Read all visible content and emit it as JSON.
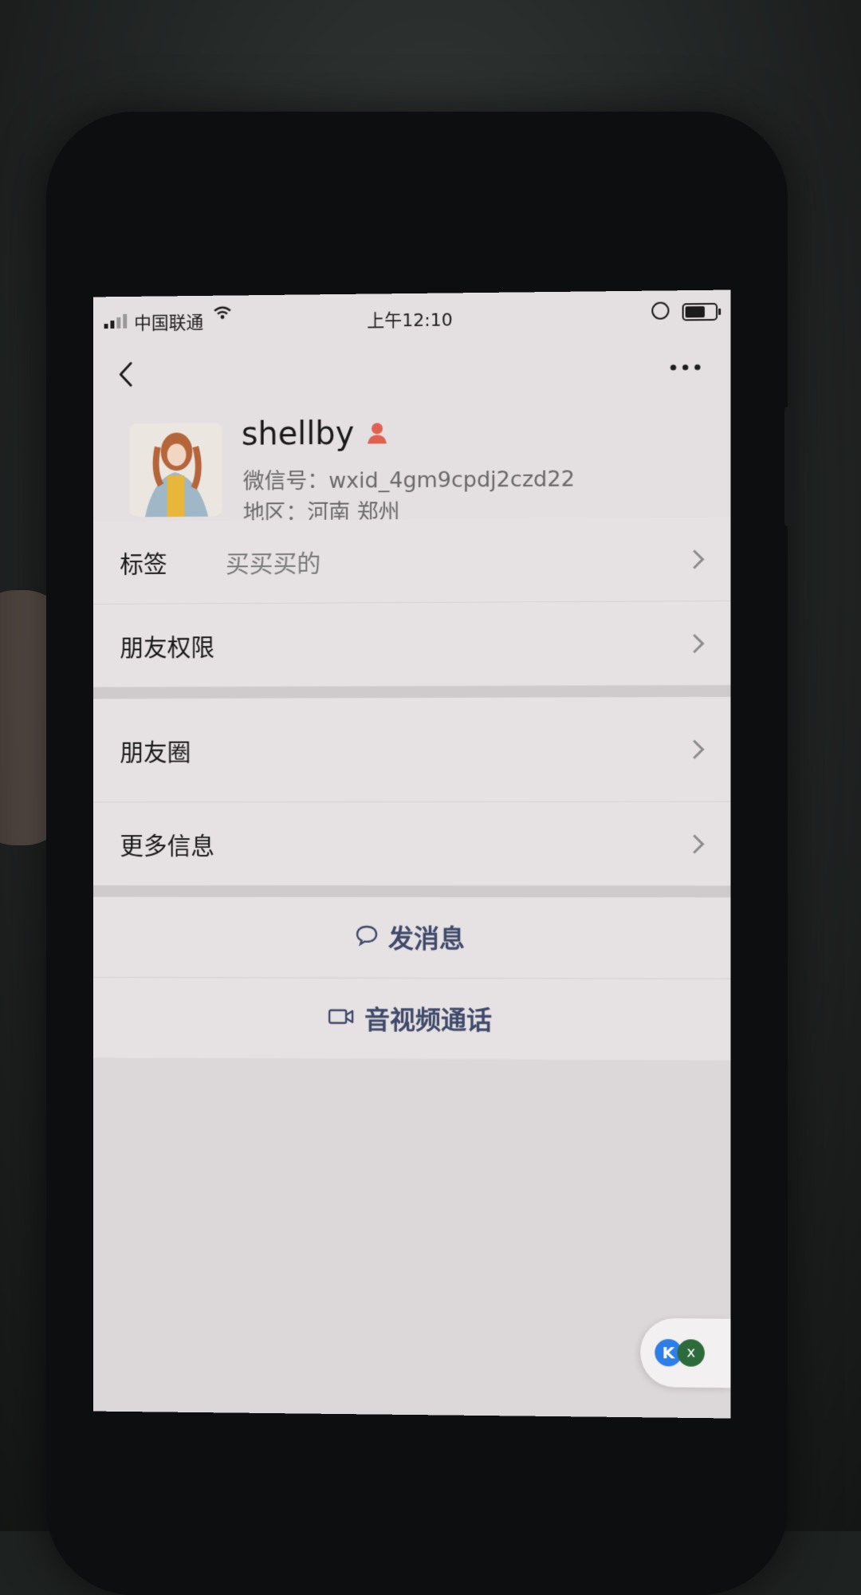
{
  "status_bar": {
    "carrier": "中国联通",
    "time": "上午12:10",
    "battery_level": 0.6
  },
  "nav": {
    "back_icon": "chevron-left-icon",
    "more_icon": "ellipsis-icon"
  },
  "profile": {
    "name": "shellby",
    "gender_icon": "female-icon",
    "gender_color": "#e0614f",
    "wechat_id": "微信号：wxid_4gm9cpdj2czd22",
    "region": "地区：河南 郑州"
  },
  "rows": {
    "tags": {
      "label": "标签",
      "value": "买买买的"
    },
    "permissions": {
      "label": "朋友权限"
    },
    "moments": {
      "label": "朋友圈"
    },
    "more_info": {
      "label": "更多信息"
    }
  },
  "actions": {
    "message": {
      "label": "发消息",
      "icon": "chat-bubble-icon"
    },
    "call": {
      "label": "音视频通话",
      "icon": "video-camera-icon"
    }
  },
  "floating": {
    "app_badge": "K",
    "close_label": "x"
  },
  "colors": {
    "screen_bg": "#e4dfe1",
    "action_text": "#3f4a6a"
  }
}
